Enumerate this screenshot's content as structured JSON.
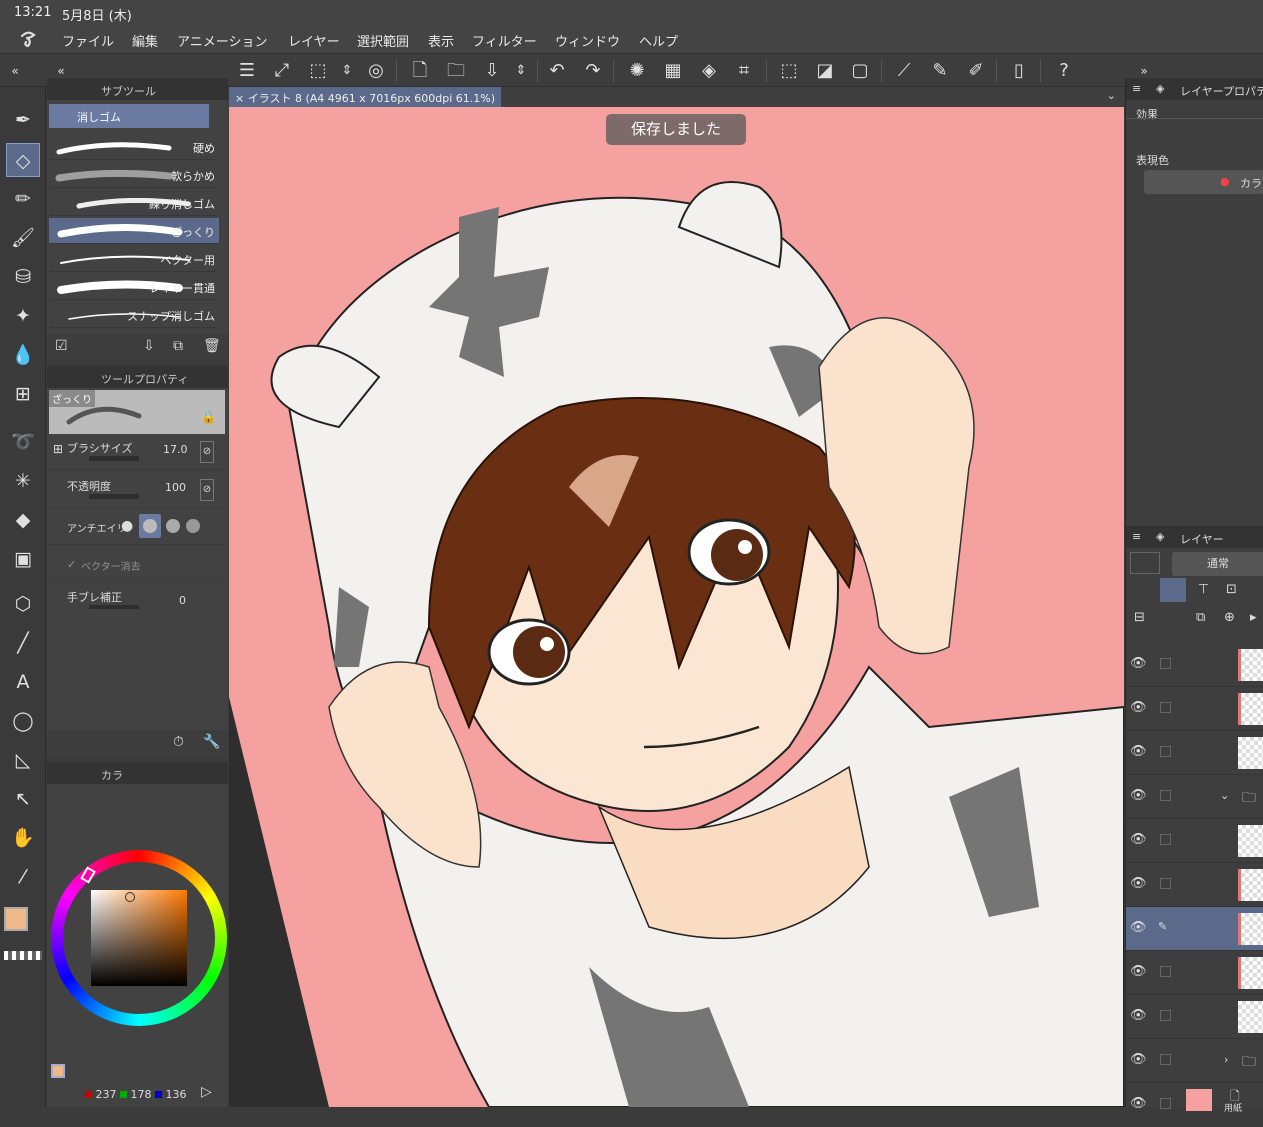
{
  "status": {
    "time": "13:21",
    "date": "5月8日 (木)"
  },
  "menu": [
    "ファイル",
    "編集",
    "アニメーション",
    "レイヤー",
    "選択範囲",
    "表示",
    "フィルター",
    "ウィンドウ",
    "ヘルプ"
  ],
  "document_tab": {
    "title": "イラスト 8 (A4 4961 x 7016px 600dpi 61.1%)",
    "close": "×"
  },
  "toast": "保存しました",
  "subtool": {
    "header": "サブツール",
    "group": "消しゴム",
    "brushes": [
      {
        "label": "硬め"
      },
      {
        "label": "軟らかめ"
      },
      {
        "label": "練り消しゴム"
      },
      {
        "label": "ざっくり",
        "selected": true
      },
      {
        "label": "ベクター用"
      },
      {
        "label": "レイヤー貫通"
      },
      {
        "label": "スナップ消しゴム"
      }
    ]
  },
  "toolprop": {
    "header": "ツールプロパティ",
    "preview_label": "ざっくり",
    "brush_size_label": "ブラシサイズ",
    "brush_size_value": "17.0",
    "opacity_label": "不透明度",
    "opacity_value": "100",
    "antialias_label": "アンチエイリ",
    "vector_label": "ベクター消去",
    "stabilization_label": "手ブレ補正",
    "stabilization_value": "0"
  },
  "colorpanel": {
    "header": "カラ",
    "main_color": "#edb98a",
    "sub_color": "#ffffff",
    "r": "237",
    "g": "178",
    "b": "136"
  },
  "layerprop": {
    "header": "レイヤープロパティ",
    "effect_label": "効果",
    "express_label": "表現色",
    "color_button": "カラ"
  },
  "layers": {
    "header": "レイヤー",
    "blend_mode": "通常",
    "bottom_label": "用紙"
  },
  "colors": {
    "canvas_bg": "#f5a1a0",
    "accent": "#5b6a8a"
  }
}
